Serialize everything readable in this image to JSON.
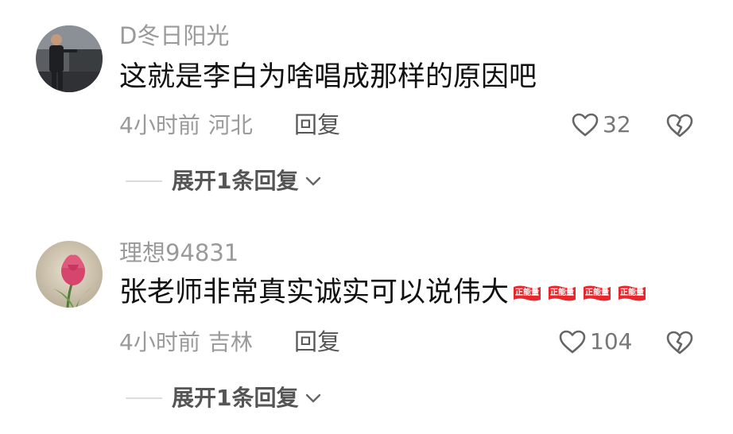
{
  "comments": [
    {
      "username": "D冬日阳光",
      "text": "这就是李白为啥唱成那样的原因吧",
      "time": "4小时前",
      "location": "河北",
      "reply_label": "回复",
      "likes": "32",
      "expand_label": "展开1条回复",
      "avatar": "avatar-man-photo",
      "badges": []
    },
    {
      "username": "理想94831",
      "text": "张老师非常真实诚实可以说伟大",
      "time": "4小时前",
      "location": "吉林",
      "reply_label": "回复",
      "likes": "104",
      "expand_label": "展开1条回复",
      "avatar": "avatar-tulip-photo",
      "badges": [
        "正能量",
        "正能量",
        "正能量",
        "正能量"
      ]
    }
  ],
  "colors": {
    "username": "#9a9a9a",
    "text": "#111111",
    "meta": "#9a9a9a",
    "badge": "#e8262b"
  },
  "icons": {
    "like": "heart-outline-icon",
    "dislike": "broken-heart-icon",
    "expand": "chevron-down-icon"
  }
}
